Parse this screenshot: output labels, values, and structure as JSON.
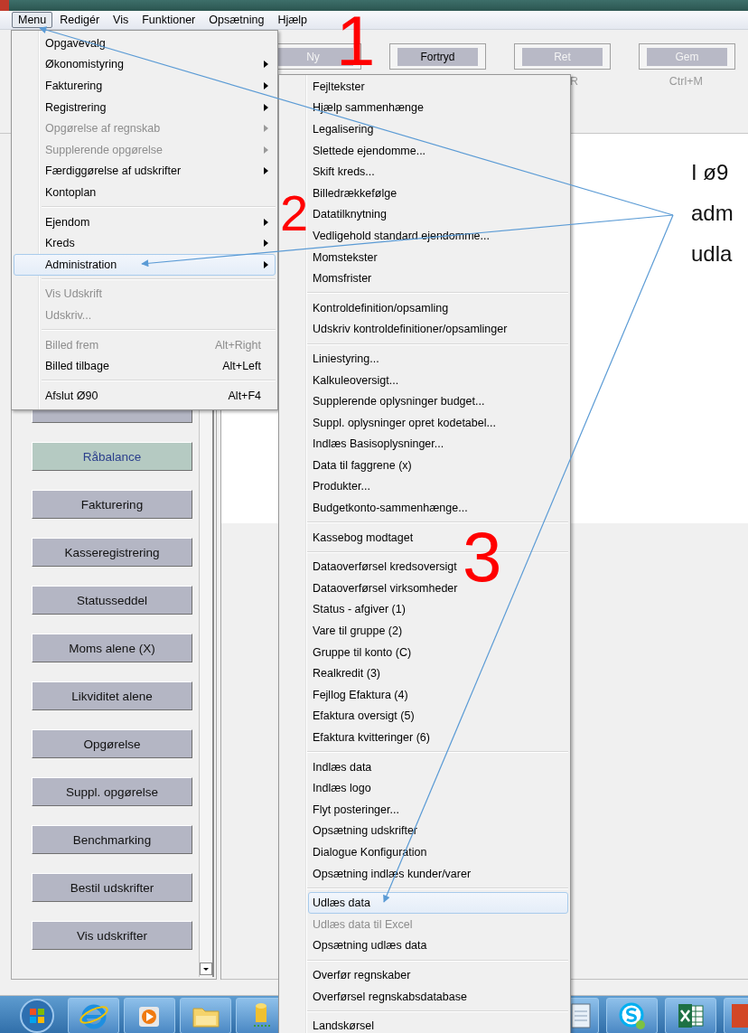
{
  "menu_bar": [
    {
      "label": "Menu",
      "selected": true
    },
    {
      "label": "Redigér",
      "selected": false
    },
    {
      "label": "Vis",
      "selected": false
    },
    {
      "label": "Funktioner",
      "selected": false
    },
    {
      "label": "Opsætning",
      "selected": false
    },
    {
      "label": "Hjælp",
      "selected": false
    }
  ],
  "toolbar": [
    {
      "label": "Ny",
      "disabled": true
    },
    {
      "label": "Fortryd",
      "disabled": false
    },
    {
      "label": "Ret",
      "disabled": true,
      "shortcut": "R"
    },
    {
      "label": "Gem",
      "disabled": true,
      "shortcut": "Ctrl+M"
    }
  ],
  "nav_buttons": [
    {
      "selected": false
    },
    {
      "label": "Råbalance",
      "selected": true
    },
    {
      "label": "Fakturering",
      "selected": false
    },
    {
      "label": "Kasseregistrering",
      "selected": false
    },
    {
      "label": "Statusseddel",
      "selected": false
    },
    {
      "label": "Moms alene (X)",
      "selected": false
    },
    {
      "label": "Likviditet alene",
      "selected": false
    },
    {
      "label": "Opgørelse",
      "selected": false
    },
    {
      "label": "Suppl. opgørelse",
      "selected": false
    },
    {
      "label": "Benchmarking",
      "selected": false
    },
    {
      "label": "Bestil udskrifter",
      "selected": false
    },
    {
      "label": "Vis udskrifter",
      "selected": false
    }
  ],
  "content_text": [
    "I ø9",
    "adm",
    "udla"
  ],
  "menu": {
    "groups": [
      [
        {
          "label": "Opgavevalg",
          "submenu": false,
          "disabled": false,
          "selected": false
        },
        {
          "label": "Økonomistyring",
          "submenu": true,
          "disabled": false,
          "selected": false
        },
        {
          "label": "Fakturering",
          "submenu": true,
          "disabled": false,
          "selected": false
        },
        {
          "label": "Registrering",
          "submenu": true,
          "disabled": false,
          "selected": false
        },
        {
          "label": "Opgørelse af regnskab",
          "submenu": true,
          "disabled": true,
          "selected": false
        },
        {
          "label": "Supplerende opgørelse",
          "submenu": true,
          "disabled": true,
          "selected": false
        },
        {
          "label": "Færdiggørelse af udskrifter",
          "submenu": true,
          "disabled": false,
          "selected": false
        },
        {
          "label": "Kontoplan",
          "submenu": false,
          "disabled": false,
          "selected": false
        }
      ],
      [
        {
          "label": "Ejendom",
          "submenu": true,
          "disabled": false,
          "selected": false
        },
        {
          "label": "Kreds",
          "submenu": true,
          "disabled": false,
          "selected": false
        },
        {
          "label": "Administration",
          "submenu": true,
          "disabled": false,
          "selected": true
        }
      ],
      [
        {
          "label": "Vis Udskrift",
          "submenu": false,
          "disabled": true,
          "selected": false
        },
        {
          "label": "Udskriv...",
          "submenu": false,
          "disabled": true,
          "selected": false
        }
      ],
      [
        {
          "label": "Billed frem",
          "shortcut": "Alt+Right",
          "submenu": false,
          "disabled": true,
          "selected": false
        },
        {
          "label": "Billed tilbage",
          "shortcut": "Alt+Left",
          "submenu": false,
          "disabled": false,
          "selected": false
        }
      ],
      [
        {
          "label": "Afslut Ø90",
          "shortcut": "Alt+F4",
          "submenu": false,
          "disabled": false,
          "selected": false
        }
      ]
    ]
  },
  "submenu": {
    "groups": [
      [
        {
          "label": "Fejltekster",
          "disabled": false,
          "selected": false
        },
        {
          "label": "Hjælp sammenhænge",
          "disabled": false,
          "selected": false
        },
        {
          "label": "Legalisering",
          "disabled": false,
          "selected": false
        },
        {
          "label": "Slettede ejendomme...",
          "disabled": false,
          "selected": false
        },
        {
          "label": "Skift kreds...",
          "disabled": false,
          "selected": false
        },
        {
          "label": "Billedrækkefølge",
          "disabled": false,
          "selected": false
        },
        {
          "label": "Datatilknytning",
          "disabled": false,
          "selected": false
        },
        {
          "label": "Vedligehold standard ejendomme...",
          "disabled": false,
          "selected": false
        },
        {
          "label": "Momstekster",
          "disabled": false,
          "selected": false
        },
        {
          "label": "Momsfrister",
          "disabled": false,
          "selected": false
        }
      ],
      [
        {
          "label": "Kontroldefinition/opsamling",
          "disabled": false,
          "selected": false
        },
        {
          "label": "Udskriv kontroldefinitioner/opsamlinger",
          "disabled": false,
          "selected": false
        }
      ],
      [
        {
          "label": "Liniestyring...",
          "disabled": false,
          "selected": false
        },
        {
          "label": "Kalkuleoversigt...",
          "disabled": false,
          "selected": false
        },
        {
          "label": "Supplerende oplysninger budget...",
          "disabled": false,
          "selected": false
        },
        {
          "label": "Suppl. oplysninger opret kodetabel...",
          "disabled": false,
          "selected": false
        },
        {
          "label": "Indlæs Basisoplysninger...",
          "disabled": false,
          "selected": false
        },
        {
          "label": "Data til faggrene (x)",
          "disabled": false,
          "selected": false
        },
        {
          "label": "Produkter...",
          "disabled": false,
          "selected": false
        },
        {
          "label": "Budgetkonto-sammenhænge...",
          "disabled": false,
          "selected": false
        }
      ],
      [
        {
          "label": "Kassebog modtaget",
          "disabled": false,
          "selected": false
        }
      ],
      [
        {
          "label": "Dataoverførsel kredsoversigt",
          "disabled": false,
          "selected": false
        },
        {
          "label": "Dataoverførsel virksomheder",
          "disabled": false,
          "selected": false
        },
        {
          "label": "Status - afgiver (1)",
          "disabled": false,
          "selected": false
        },
        {
          "label": "Vare til gruppe (2)",
          "disabled": false,
          "selected": false
        },
        {
          "label": "Gruppe til konto (C)",
          "disabled": false,
          "selected": false
        },
        {
          "label": "Realkredit (3)",
          "disabled": false,
          "selected": false
        },
        {
          "label": "Fejllog Efaktura (4)",
          "disabled": false,
          "selected": false
        },
        {
          "label": "Efaktura oversigt (5)",
          "disabled": false,
          "selected": false
        },
        {
          "label": "Efaktura kvitteringer (6)",
          "disabled": false,
          "selected": false
        }
      ],
      [
        {
          "label": "Indlæs data",
          "disabled": false,
          "selected": false
        },
        {
          "label": "Indlæs logo",
          "disabled": false,
          "selected": false
        },
        {
          "label": "Flyt posteringer...",
          "disabled": false,
          "selected": false
        },
        {
          "label": "Opsætning udskrifter",
          "disabled": false,
          "selected": false
        },
        {
          "label": "Dialogue Konfiguration",
          "disabled": false,
          "selected": false
        },
        {
          "label": "Opsætning indlæs kunder/varer",
          "disabled": false,
          "selected": false
        }
      ],
      [
        {
          "label": "Udlæs data",
          "disabled": false,
          "selected": true
        },
        {
          "label": "Udlæs data til Excel",
          "disabled": true,
          "selected": false
        },
        {
          "label": "Opsætning udlæs data",
          "disabled": false,
          "selected": false
        }
      ],
      [
        {
          "label": "Overfør regnskaber",
          "disabled": false,
          "selected": false
        },
        {
          "label": "Overførsel regnskabsdatabase",
          "disabled": false,
          "selected": false
        }
      ],
      [
        {
          "label": "Landskørsel",
          "disabled": false,
          "selected": false
        }
      ]
    ]
  },
  "taskbar_left": [
    {
      "kind": "start"
    },
    {
      "kind": "browser"
    },
    {
      "kind": "media"
    },
    {
      "kind": "folder"
    },
    {
      "kind": "database"
    }
  ],
  "taskbar_right": [
    {
      "kind": "notepad"
    },
    {
      "kind": "skype"
    },
    {
      "kind": "excel"
    },
    {
      "kind": "presentation"
    }
  ],
  "annotation_numbers": [
    "1",
    "2",
    "3"
  ]
}
